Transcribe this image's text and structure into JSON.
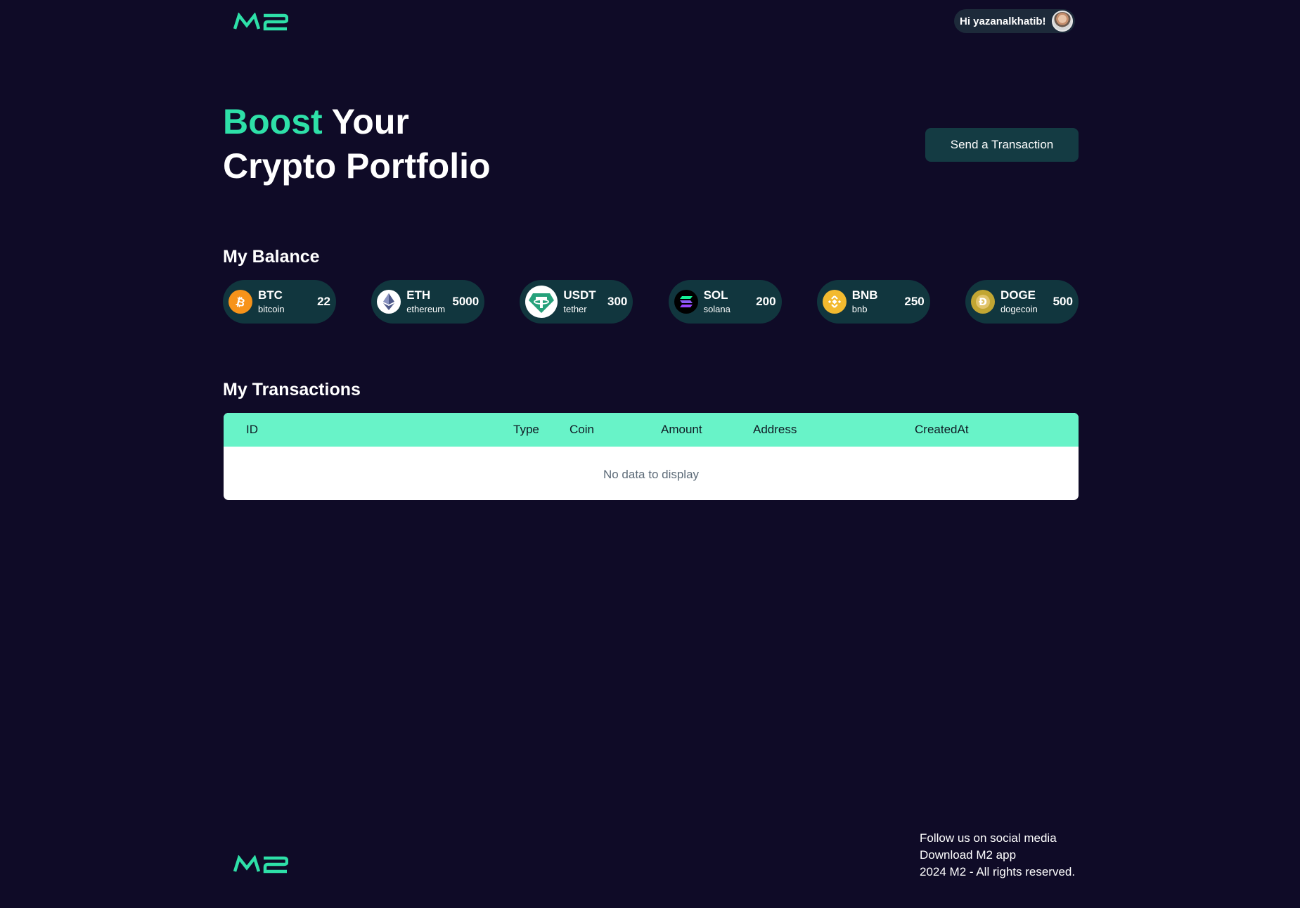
{
  "header": {
    "logo_text": "M2",
    "greeting": "Hi yazanalkhatib!",
    "avatar_icon": "user-avatar"
  },
  "hero": {
    "title_accent": "Boost",
    "title_rest_line1": "Your",
    "title_line2": "Crypto Portfolio",
    "send_button_label": "Send a Transaction"
  },
  "balance": {
    "title": "My Balance",
    "coins": [
      {
        "symbol": "BTC",
        "name": "bitcoin",
        "amount": "22",
        "icon": "bitcoin-icon",
        "color": "#f7931a"
      },
      {
        "symbol": "ETH",
        "name": "ethereum",
        "amount": "5000",
        "icon": "ethereum-icon",
        "color": "#ffffff"
      },
      {
        "symbol": "USDT",
        "name": "tether",
        "amount": "300",
        "icon": "tether-icon",
        "color": "#26a17b"
      },
      {
        "symbol": "SOL",
        "name": "solana",
        "amount": "200",
        "icon": "solana-icon",
        "color": "#000000"
      },
      {
        "symbol": "BNB",
        "name": "bnb",
        "amount": "250",
        "icon": "bnb-icon",
        "color": "#f3ba2f"
      },
      {
        "symbol": "DOGE",
        "name": "dogecoin",
        "amount": "500",
        "icon": "dogecoin-icon",
        "color": "#c2a633"
      }
    ]
  },
  "transactions": {
    "title": "My Transactions",
    "columns": [
      "ID",
      "Type",
      "Coin",
      "Amount",
      "Address",
      "CreatedAt"
    ],
    "empty_text": "No data to display"
  },
  "footer": {
    "logo_text": "M2",
    "links": [
      "Follow us on social media",
      "Download M2 app",
      "2024 M2 - All rights reserved."
    ]
  },
  "colors": {
    "background": "#0f0b27",
    "accent": "#2ee0a8",
    "table_header": "#68f3c8",
    "card": "#11363e"
  }
}
